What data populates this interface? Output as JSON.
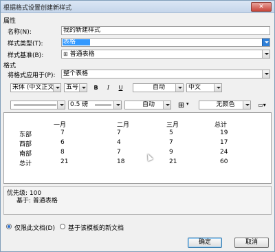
{
  "window": {
    "title": "根据格式设置创建新样式",
    "close_label": "✕"
  },
  "properties": {
    "section_label": "属性",
    "name_label": "名称(N):",
    "name_value": "我的新建样式",
    "style_type_label": "样式类型(T):",
    "style_type_value": "表格",
    "based_on_label": "样式基准(B):",
    "based_on_value": "普通表格",
    "based_on_icon": "table-icon"
  },
  "format": {
    "section_label": "格式",
    "apply_to_label": "将格式应用于(P):",
    "apply_to_value": "整个表格",
    "font_value": "宋体 (中文正文",
    "size_value": "五号",
    "bold_label": "B",
    "italic_label": "I",
    "underline_label": "U",
    "color_value": "自动",
    "lang_value": "中文",
    "border_width_value": "0.5 磅",
    "border_color_value": "自动",
    "shading_value": "无颜色"
  },
  "preview": {
    "headers": [
      "一月",
      "二月",
      "三月",
      "总计"
    ],
    "rows": [
      {
        "label": "东部",
        "values": [
          "7",
          "7",
          "5",
          "19"
        ]
      },
      {
        "label": "西部",
        "values": [
          "6",
          "4",
          "7",
          "17"
        ]
      },
      {
        "label": "南部",
        "values": [
          "8",
          "7",
          "9",
          "24"
        ]
      },
      {
        "label": "总计",
        "values": [
          "21",
          "18",
          "21",
          "60"
        ]
      }
    ]
  },
  "description": {
    "line1": "优先级: 100",
    "line2": "基于: 普通表格"
  },
  "options": {
    "only_this_doc": "仅限此文档(D)",
    "new_docs_template": "基于该模板的新文档"
  },
  "buttons": {
    "ok": "确定",
    "cancel": "取消"
  },
  "colors": {
    "accent": "#3399ff",
    "title_bg": "#c5d6ea"
  }
}
